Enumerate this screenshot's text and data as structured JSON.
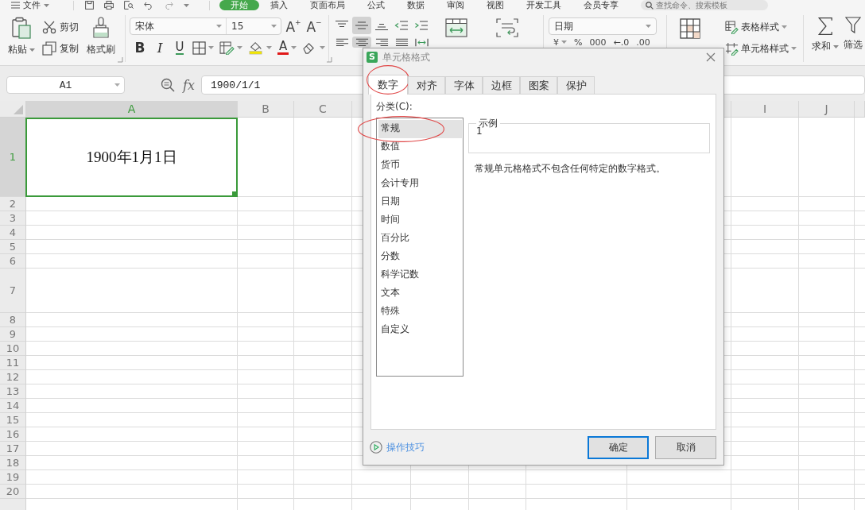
{
  "menu_bar": {
    "file_menu": "文件",
    "tabs": [
      {
        "label": "开始",
        "selected": true
      },
      {
        "label": "插入",
        "selected": false
      },
      {
        "label": "页面布局",
        "selected": false
      },
      {
        "label": "公式",
        "selected": false
      },
      {
        "label": "数据",
        "selected": false
      },
      {
        "label": "审阅",
        "selected": false
      },
      {
        "label": "视图",
        "selected": false
      },
      {
        "label": "开发工具",
        "selected": false
      },
      {
        "label": "会员专享",
        "selected": false
      }
    ],
    "search": {
      "placeholder": "查找命令、搜索模板"
    }
  },
  "ribbon": {
    "clipboard": {
      "paste": "粘贴",
      "cut": "剪切",
      "copy": "复制",
      "format_painter": "格式刷"
    },
    "font": {
      "name": "宋体",
      "size": "15",
      "grow": "A$^{+}$",
      "shrink": "A$^{−}$",
      "bold": "B",
      "italic": "I",
      "underline": "U",
      "font_color": "A"
    },
    "alignment": [
      {
        "kind": "top",
        "selected": false
      },
      {
        "kind": "middle",
        "selected": true
      },
      {
        "kind": "bottom",
        "selected": false
      },
      {
        "kind": "outdent",
        "selected": false
      },
      {
        "kind": "indent",
        "selected": false
      },
      {
        "kind": "left",
        "selected": false
      },
      {
        "kind": "center",
        "selected": true
      },
      {
        "kind": "right",
        "selected": false
      },
      {
        "kind": "justify",
        "selected": false
      },
      {
        "kind": "distributed",
        "selected": false
      }
    ],
    "number": {
      "format": "日期",
      "buttons": [
        "¥",
        "%",
        "000",
        "←.0",
        ".00"
      ]
    },
    "styles": {
      "table_style": "表格样式",
      "cell_style": "单元格样式"
    },
    "editing": {
      "sum": "求和",
      "filter": "筛选"
    }
  },
  "formula_bar": {
    "name_box": "A1",
    "fx": "fx",
    "value": "1900/1/1"
  },
  "sheet": {
    "columns": [
      {
        "label": "A",
        "selected": true
      },
      {
        "label": "B",
        "selected": false
      },
      {
        "label": "C",
        "selected": false
      },
      {
        "label": "I",
        "selected": false
      },
      {
        "label": "J",
        "selected": false
      }
    ],
    "rows": [
      {
        "label": "1",
        "selected": true
      },
      {
        "label": "2",
        "selected": false
      },
      {
        "label": "3",
        "selected": false
      },
      {
        "label": "4",
        "selected": false
      },
      {
        "label": "5",
        "selected": false
      },
      {
        "label": "6",
        "selected": false
      },
      {
        "label": "7",
        "selected": false
      },
      {
        "label": "8",
        "selected": false
      },
      {
        "label": "9",
        "selected": false
      },
      {
        "label": "10",
        "selected": false
      },
      {
        "label": "11",
        "selected": false
      },
      {
        "label": "12",
        "selected": false
      },
      {
        "label": "13",
        "selected": false
      },
      {
        "label": "14",
        "selected": false
      },
      {
        "label": "15",
        "selected": false
      },
      {
        "label": "16",
        "selected": false
      },
      {
        "label": "17",
        "selected": false
      },
      {
        "label": "18",
        "selected": false
      },
      {
        "label": "19",
        "selected": false
      },
      {
        "label": "20",
        "selected": false
      }
    ],
    "active_cell": {
      "value": "1900年1月1日"
    }
  },
  "dialog": {
    "logo": "S",
    "title": "单元格格式",
    "tabs": [
      {
        "label": "数字",
        "selected": true,
        "circled": true
      },
      {
        "label": "对齐",
        "selected": false,
        "circled": false
      },
      {
        "label": "字体",
        "selected": false,
        "circled": false
      },
      {
        "label": "边框",
        "selected": false,
        "circled": false
      },
      {
        "label": "图案",
        "selected": false,
        "circled": false
      },
      {
        "label": "保护",
        "selected": false,
        "circled": false
      }
    ],
    "category_label": "分类(C):",
    "categories": [
      {
        "label": "常规",
        "selected": true,
        "circled": true
      },
      {
        "label": "数值",
        "selected": false,
        "circled": false
      },
      {
        "label": "货币",
        "selected": false,
        "circled": false
      },
      {
        "label": "会计专用",
        "selected": false,
        "circled": false
      },
      {
        "label": "日期",
        "selected": false,
        "circled": false
      },
      {
        "label": "时间",
        "selected": false,
        "circled": false
      },
      {
        "label": "百分比",
        "selected": false,
        "circled": false
      },
      {
        "label": "分数",
        "selected": false,
        "circled": false
      },
      {
        "label": "科学记数",
        "selected": false,
        "circled": false
      },
      {
        "label": "文本",
        "selected": false,
        "circled": false
      },
      {
        "label": "特殊",
        "selected": false,
        "circled": false
      },
      {
        "label": "自定义",
        "selected": false,
        "circled": false
      }
    ],
    "sample": {
      "legend": "示例",
      "value": "1"
    },
    "description": "常规单元格格式不包含任何特定的数字格式。",
    "tips_link": "操作技巧",
    "buttons": [
      {
        "label": "确定",
        "kind": "default"
      },
      {
        "label": "取消",
        "kind": "normal"
      }
    ]
  }
}
